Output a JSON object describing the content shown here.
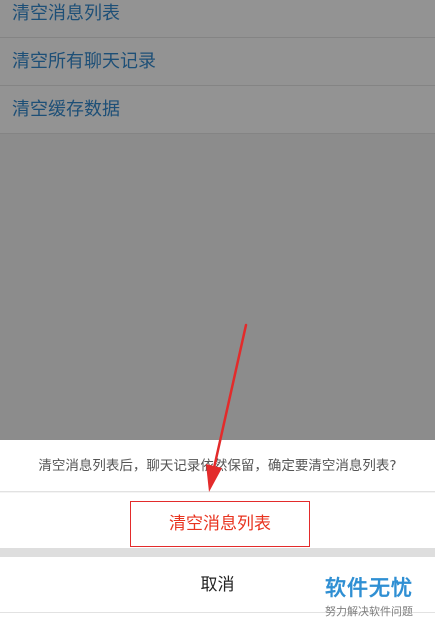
{
  "background_list": {
    "items": [
      {
        "label": "清空消息列表"
      },
      {
        "label": "清空所有聊天记录"
      },
      {
        "label": "清空缓存数据"
      }
    ]
  },
  "dialog": {
    "message": "清空消息列表后，聊天记录依然保留，确定要清空消息列表?",
    "confirm_label": "清空消息列表",
    "cancel_label": "取消"
  },
  "watermark": {
    "title": "软件无忧",
    "subtitle": "努力解决软件问题"
  },
  "colors": {
    "overlay": "#8c8c8c",
    "list_text": "#1d4f77",
    "confirm_text": "#e8331f",
    "annotation_red": "#e32b2b",
    "watermark_blue": "#2f8fd3"
  },
  "icons": {
    "annotation": "red-arrow-icon"
  }
}
